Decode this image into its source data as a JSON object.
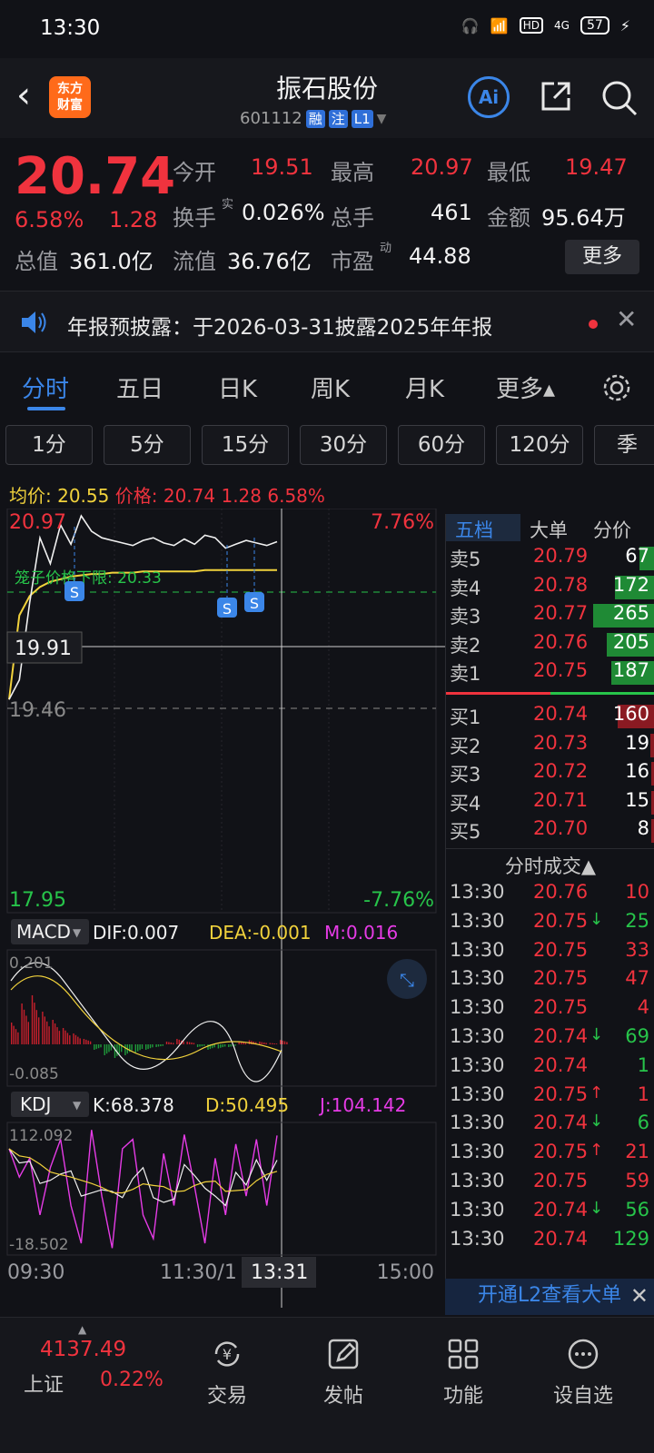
{
  "status": {
    "time": "13:30",
    "battery": "57",
    "hd": "HD",
    "net": "4G"
  },
  "nav": {
    "logo_line1": "东方",
    "logo_line2": "财富",
    "title": "振石股份",
    "code": "601112",
    "tag1": "融",
    "tag2": "注",
    "tag3": "L1",
    "ai": "Ai"
  },
  "quote": {
    "price": "20.74",
    "pct": "6.58%",
    "chg": "1.28",
    "open_label": "今开",
    "open": "19.51",
    "high_label": "最高",
    "high": "20.97",
    "low_label": "最低",
    "low": "19.47",
    "turnover_label": "换手",
    "turnover_sup": "实",
    "turnover": "0.026%",
    "vol_label": "总手",
    "vol": "461",
    "amt_label": "金额",
    "amt": "95.64万",
    "mcap_label": "总值",
    "mcap": "361.0亿",
    "float_label": "流值",
    "float": "36.76亿",
    "pe_label": "市盈",
    "pe_sup": "动",
    "pe": "44.88",
    "more": "更多"
  },
  "notice": {
    "text": "年报预披露：于2026-03-31披露2025年年报"
  },
  "tabs": [
    "分时",
    "五日",
    "日K",
    "周K",
    "月K",
    "更多▴"
  ],
  "periods": [
    "1分",
    "5分",
    "15分",
    "30分",
    "60分",
    "120分",
    "季"
  ],
  "avg": {
    "avg_label": "均价:",
    "avg": "20.55",
    "price_label": "价格:",
    "price": "20.74",
    "chg": "1.28",
    "pct": "6.58%"
  },
  "chart_data": {
    "type": "line",
    "main": {
      "ymax": "20.97",
      "ymin": "17.95",
      "pct_max": "7.76%",
      "pct_min": "-7.76%",
      "mid": "19.46",
      "cursor_label": "19.91",
      "limit_label": "笼子价格下限: 20.33",
      "price": [
        19.55,
        19.7,
        20.3,
        20.8,
        20.6,
        20.9,
        20.75,
        20.97,
        20.85,
        20.8,
        20.78,
        20.76,
        20.74,
        20.78,
        20.8,
        20.76,
        20.74,
        20.79,
        20.75,
        20.82,
        20.8,
        20.72,
        20.75,
        20.78,
        20.76,
        20.74,
        20.77
      ],
      "avg": [
        19.55,
        20.2,
        20.35,
        20.42,
        20.46,
        20.48,
        20.5,
        20.51,
        20.52,
        20.52,
        20.53,
        20.53,
        20.53,
        20.54,
        20.54,
        20.54,
        20.54,
        20.54,
        20.54,
        20.55,
        20.55,
        20.55,
        20.55,
        20.55,
        20.55,
        20.55,
        20.55
      ]
    },
    "macd": {
      "name": "MACD",
      "dif_label": "DIF:0.007",
      "dea_label": "DEA:-0.001",
      "m_label": "M:0.016",
      "top": "0.201",
      "bottom": "-0.085",
      "bars": [
        0.08,
        0.15,
        0.18,
        0.12,
        0.09,
        0.06,
        0.04,
        0.02,
        -0.02,
        -0.04,
        -0.05,
        -0.04,
        -0.03,
        -0.02,
        -0.01,
        0.01,
        0.02,
        0.01,
        -0.01,
        -0.02,
        -0.015,
        -0.01,
        0.01,
        0.015,
        0.01,
        0.005,
        0.016
      ]
    },
    "kdj": {
      "name": "KDJ",
      "k_label": "K:68.378",
      "d_label": "D:50.495",
      "j_label": "J:104.142",
      "top": "112.092",
      "bottom": "-18.502",
      "j": [
        90,
        60,
        80,
        20,
        70,
        100,
        30,
        -10,
        110,
        40,
        -15,
        90,
        100,
        20,
        -5,
        85,
        30,
        105,
        50,
        -10,
        80,
        20,
        95,
        40,
        100,
        30,
        104
      ]
    },
    "x_labels": [
      "09:30",
      "11:30/1",
      "13:31",
      "15:00"
    ]
  },
  "book": {
    "tabs": [
      "五档",
      "大单",
      "分价"
    ],
    "asks": [
      {
        "l": "卖5",
        "p": "20.79",
        "v": "67"
      },
      {
        "l": "卖4",
        "p": "20.78",
        "v": "172"
      },
      {
        "l": "卖3",
        "p": "20.77",
        "v": "265"
      },
      {
        "l": "卖2",
        "p": "20.76",
        "v": "205"
      },
      {
        "l": "卖1",
        "p": "20.75",
        "v": "187"
      }
    ],
    "bids": [
      {
        "l": "买1",
        "p": "20.74",
        "v": "160"
      },
      {
        "l": "买2",
        "p": "20.73",
        "v": "19"
      },
      {
        "l": "买3",
        "p": "20.72",
        "v": "16"
      },
      {
        "l": "买4",
        "p": "20.71",
        "v": "15"
      },
      {
        "l": "买5",
        "p": "20.70",
        "v": "8"
      }
    ],
    "trades_title": "分时成交▲",
    "trades": [
      {
        "t": "13:30",
        "p": "20.76",
        "a": "",
        "v": "10",
        "c": "red"
      },
      {
        "t": "13:30",
        "p": "20.75",
        "a": "↓",
        "v": "25",
        "c": "green"
      },
      {
        "t": "13:30",
        "p": "20.75",
        "a": "",
        "v": "33",
        "c": "red"
      },
      {
        "t": "13:30",
        "p": "20.75",
        "a": "",
        "v": "47",
        "c": "red"
      },
      {
        "t": "13:30",
        "p": "20.75",
        "a": "",
        "v": "4",
        "c": "red"
      },
      {
        "t": "13:30",
        "p": "20.74",
        "a": "↓",
        "v": "69",
        "c": "green"
      },
      {
        "t": "13:30",
        "p": "20.74",
        "a": "",
        "v": "1",
        "c": "green"
      },
      {
        "t": "13:30",
        "p": "20.75",
        "a": "↑",
        "v": "1",
        "c": "red"
      },
      {
        "t": "13:30",
        "p": "20.74",
        "a": "↓",
        "v": "6",
        "c": "green"
      },
      {
        "t": "13:30",
        "p": "20.75",
        "a": "↑",
        "v": "21",
        "c": "red"
      },
      {
        "t": "13:30",
        "p": "20.75",
        "a": "",
        "v": "59",
        "c": "red"
      },
      {
        "t": "13:30",
        "p": "20.74",
        "a": "↓",
        "v": "56",
        "c": "green"
      },
      {
        "t": "13:30",
        "p": "20.74",
        "a": "",
        "v": "129",
        "c": "green"
      }
    ],
    "l2": "开通L2查看大单"
  },
  "bottom": {
    "index_val": "4137.49",
    "index_name": "上证",
    "index_pct": "0.22%",
    "items": [
      "交易",
      "发帖",
      "功能",
      "设自选"
    ]
  }
}
